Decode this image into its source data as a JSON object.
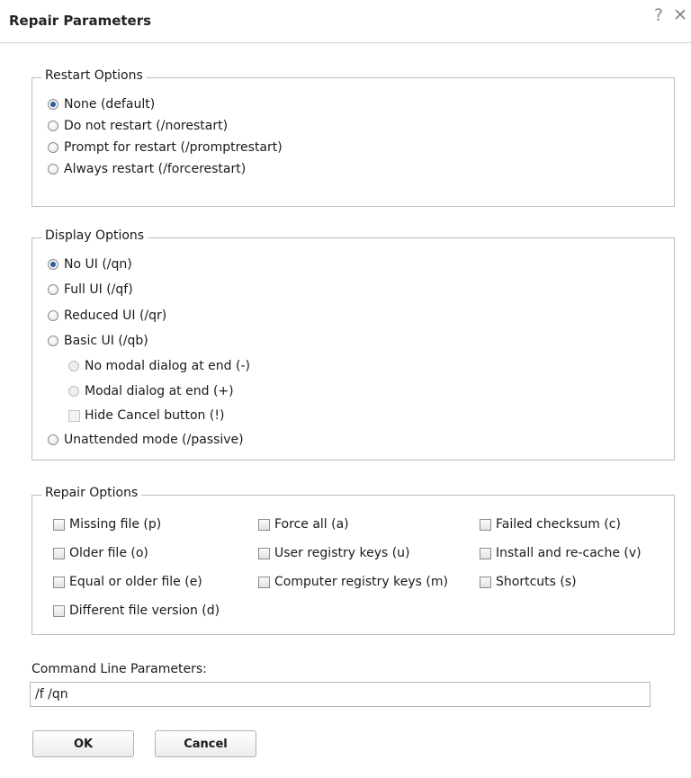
{
  "window": {
    "title": "Repair Parameters",
    "help_icon": "?",
    "close_icon": "✕"
  },
  "restart_options": {
    "legend": "Restart Options",
    "items": [
      {
        "label": "None (default)",
        "selected": true
      },
      {
        "label": "Do not restart (/norestart)",
        "selected": false
      },
      {
        "label": "Prompt for restart (/promptrestart)",
        "selected": false
      },
      {
        "label": "Always restart (/forcerestart)",
        "selected": false
      }
    ]
  },
  "display_options": {
    "legend": "Display Options",
    "items": [
      {
        "label": "No UI (/qn)",
        "selected": true
      },
      {
        "label": "Full UI (/qf)",
        "selected": false
      },
      {
        "label": "Reduced UI (/qr)",
        "selected": false
      },
      {
        "label": "Basic UI (/qb)",
        "selected": false
      },
      {
        "label": "Unattended mode (/passive)",
        "selected": false
      }
    ],
    "basic_sub": {
      "no_modal": "No modal dialog at end (-)",
      "modal": "Modal dialog at end (+)",
      "hide_cancel": "Hide Cancel button (!)"
    }
  },
  "repair_options": {
    "legend": "Repair Options",
    "items": [
      {
        "label": "Missing file (p)",
        "checked": false
      },
      {
        "label": "Force all (a)",
        "checked": false
      },
      {
        "label": "Failed checksum (c)",
        "checked": false
      },
      {
        "label": "Older file (o)",
        "checked": false
      },
      {
        "label": "User registry keys (u)",
        "checked": false
      },
      {
        "label": "Install and re-cache (v)",
        "checked": false
      },
      {
        "label": "Equal or older file (e)",
        "checked": false
      },
      {
        "label": "Computer registry keys (m)",
        "checked": false
      },
      {
        "label": "Shortcuts (s)",
        "checked": false
      },
      {
        "label": "Different file version (d)",
        "checked": false
      }
    ]
  },
  "command_line": {
    "label": "Command Line Parameters:",
    "value": "/f /qn"
  },
  "buttons": {
    "ok": "OK",
    "cancel": "Cancel"
  },
  "colors": {
    "radio_dot": "#2a5d9c",
    "border": "#bdbdbd"
  }
}
